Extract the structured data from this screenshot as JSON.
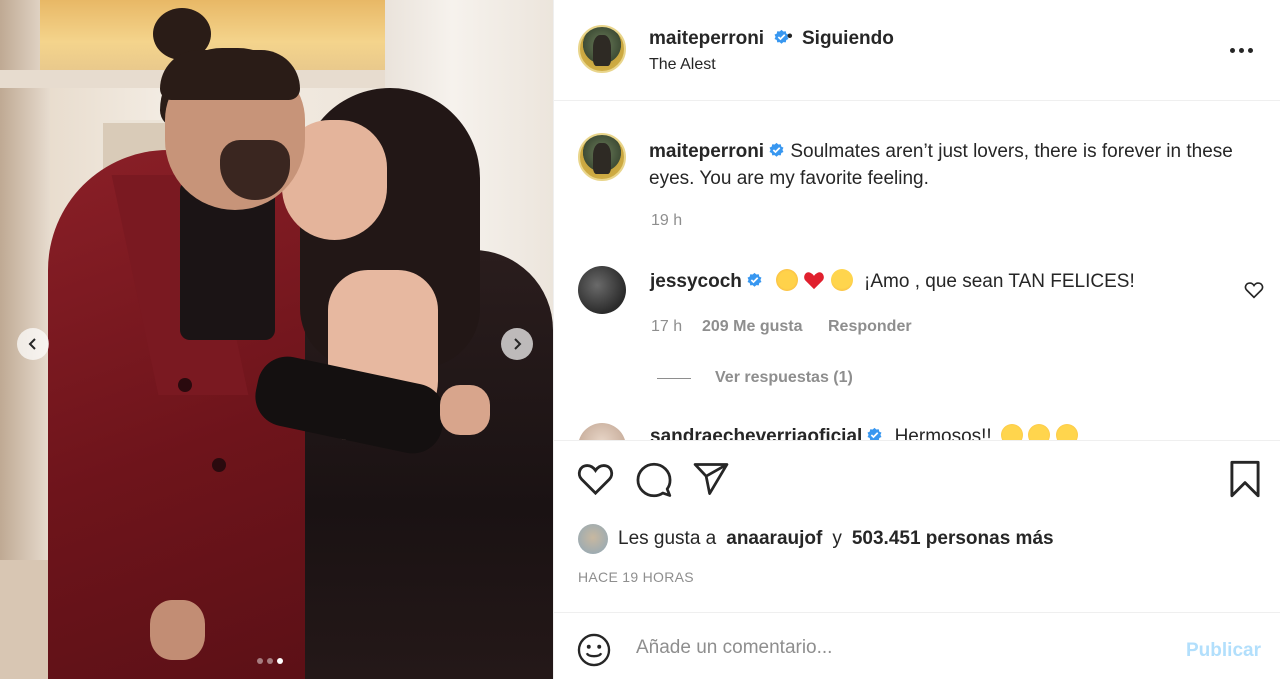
{
  "post": {
    "photo_index": 3,
    "photo_count": 3
  },
  "header": {
    "username": "maiteperroni",
    "separator": "•",
    "follow_status": "Siguiendo",
    "location": "The Alest"
  },
  "caption": {
    "username": "maiteperroni",
    "text": "Soulmates aren’t just lovers, there is forever in these eyes. You are my favorite feeling.",
    "time": "19 h"
  },
  "comments": [
    {
      "username": "jessycoch",
      "emojis": [
        "raising-hands-emoji",
        "red-heart-emoji",
        "heart-eyes-emoji"
      ],
      "text": "¡Amo , que sean TAN FELICES!",
      "time": "17 h",
      "likes": "209 Me gusta",
      "reply_label": "Responder",
      "view_replies": "Ver respuestas (1)"
    },
    {
      "username": "sandraecheverriaoficial",
      "text": "Hermosos!!"
    }
  ],
  "likes": {
    "prefix": "Les gusta a",
    "liked_by": "anaaraujof",
    "conjunction": "y",
    "others": "503.451 personas más"
  },
  "posted_ago": "HACE 19 HORAS",
  "comment_box": {
    "placeholder": "Añade un comentario...",
    "publish_label": "Publicar"
  },
  "colors": {
    "verified": "#3897f0",
    "heart_red": "#ed4956",
    "publish_disabled": "#b2dffc",
    "secondary_text": "#8e8e8e"
  }
}
